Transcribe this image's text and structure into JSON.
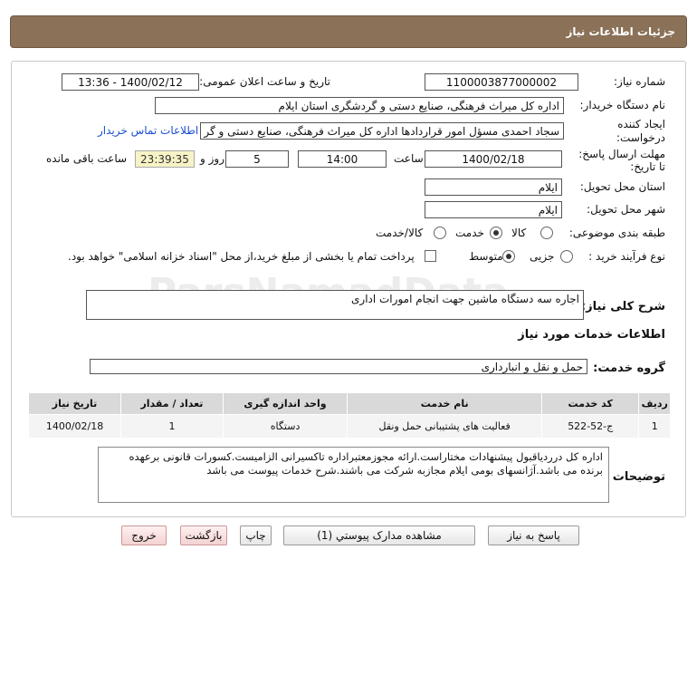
{
  "header": {
    "title": "جزئیات اطلاعات نیاز"
  },
  "fields": {
    "need_number_label": "شماره نیاز:",
    "need_number": "1100003877000002",
    "announce_label": "تاریخ و ساعت اعلان عمومی:",
    "announce_value": "1400/02/12 - 13:36",
    "buyer_org_label": "نام دستگاه خریدار:",
    "buyer_org": "اداره کل میراث فرهنگی، صنایع دستی و گردشگری استان ایلام",
    "creator_label": "ایجاد کننده درخواست:",
    "creator": "سجاد احمدی مسؤل امور قراردادها اداره کل میراث فرهنگی، صنایع دستی و گر",
    "contact_link": "اطلاعات تماس خریدار",
    "deadline_label": "مهلت ارسال پاسخ:",
    "deadline_label2": "تا تاریخ:",
    "deadline_date": "1400/02/18",
    "time_label": "ساعت",
    "deadline_time": "14:00",
    "days_value": "5",
    "days_label": "روز و",
    "remaining_time": "23:39:35",
    "remaining_label": "ساعت باقی مانده",
    "province_label": "استان محل تحویل:",
    "province": "ایلام",
    "city_label": "شهر محل تحویل:",
    "city": "ایلام",
    "category_label": "طبقه بندی موضوعی:",
    "category_options": [
      "کالا",
      "خدمت",
      "کالا/خدمت"
    ],
    "category_selected": "خدمت",
    "process_label": "نوع فرآیند خرید :",
    "process_options": [
      "جزیی",
      "متوسط"
    ],
    "process_selected": "متوسط",
    "payment_note": "پرداخت تمام یا بخشی از مبلغ خرید،از محل \"اسناد خزانه اسلامی\" خواهد بود."
  },
  "summary": {
    "label": "شرح کلی نیاز:",
    "value": "اجاره سه دستگاه ماشین جهت انجام امورات اداری"
  },
  "services_info": {
    "title": "اطلاعات خدمات مورد نیاز",
    "group_label": "گروه خدمت:",
    "group_value": "حمل و نقل و انبارداری"
  },
  "table": {
    "headers": [
      "ردیف",
      "کد خدمت",
      "نام خدمت",
      "واحد اندازه گیری",
      "تعداد / مقدار",
      "تاریخ نیاز"
    ],
    "rows": [
      [
        "1",
        "ج-52-522",
        "فعالیت های پشتیبانی حمل ونقل",
        "دستگاه",
        "1",
        "1400/02/18"
      ]
    ]
  },
  "buyer_notes": {
    "label": "توضیحات خریدار:",
    "text": "اداره کل درردیاقبول پیشنهادات مختاراست.ارائه مجوزمعتبراداره تاکسیرانی الزامیست.کسورات قانونی برعهده برنده می باشد.آژانسهای بومی ایلام مجازبه شرکت می باشند.شرح خدمات پیوست می باشد"
  },
  "buttons": {
    "reply": "پاسخ به نیاز",
    "attachments": "مشاهده مدارک پیوستي (1)",
    "print": "چاپ",
    "back": "بازگشت",
    "exit": "خروج"
  },
  "watermark": {
    "text": "ParsNamadData"
  }
}
